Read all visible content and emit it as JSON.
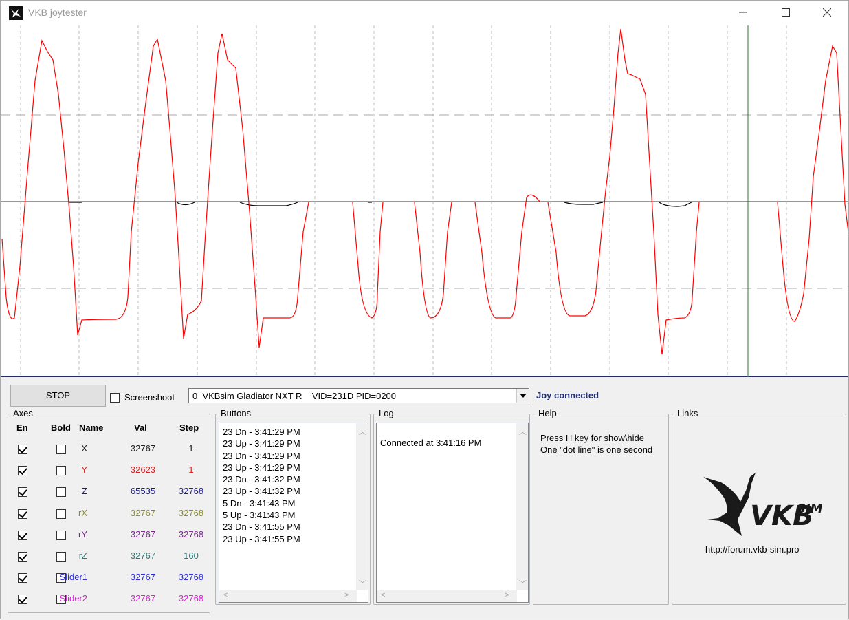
{
  "window": {
    "title": "VKB joytester"
  },
  "controls": {
    "stop_label": "STOP",
    "screenshot_label": "Screenshoot",
    "device_selected": "0  VKBsim Gladiator NXT R    VID=231D PID=0200",
    "status": "Joy connected"
  },
  "axes": {
    "title": "Axes",
    "headers": {
      "en": "En",
      "bold": "Bold",
      "name": "Name",
      "val": "Val",
      "step": "Step"
    },
    "rows": [
      {
        "name": "X",
        "val": "32767",
        "step": "1",
        "color": "#202020",
        "enabled": true,
        "bold": false
      },
      {
        "name": "Y",
        "val": "32623",
        "step": "1",
        "color": "#e02020",
        "enabled": true,
        "bold": false
      },
      {
        "name": "Z",
        "val": "65535",
        "step": "32768",
        "color": "#1a1a8c",
        "enabled": true,
        "bold": false
      },
      {
        "name": "rX",
        "val": "32767",
        "step": "32768",
        "color": "#8a8a2a",
        "enabled": true,
        "bold": false
      },
      {
        "name": "rY",
        "val": "32767",
        "step": "32768",
        "color": "#7a2a8a",
        "enabled": true,
        "bold": false
      },
      {
        "name": "rZ",
        "val": "32767",
        "step": "160",
        "color": "#2a7a7a",
        "enabled": true,
        "bold": false
      },
      {
        "name": "Slider1",
        "val": "32767",
        "step": "32768",
        "color": "#2a2ae0",
        "enabled": true,
        "bold": false
      },
      {
        "name": "Slider2",
        "val": "32767",
        "step": "32768",
        "color": "#e020e0",
        "enabled": true,
        "bold": false
      }
    ]
  },
  "buttons_log": {
    "title": "Buttons",
    "entries": [
      "23 Dn - 3:41:29 PM",
      "23 Up - 3:41:29 PM",
      "23 Dn - 3:41:29 PM",
      "23 Up - 3:41:29 PM",
      "23 Dn - 3:41:32 PM",
      "23 Up - 3:41:32 PM",
      "5 Dn - 3:41:43 PM",
      "5 Up - 3:41:43 PM",
      "23 Dn - 3:41:55 PM",
      "23 Up - 3:41:55 PM"
    ]
  },
  "log": {
    "title": "Log",
    "entries": [
      "Connected at 3:41:16 PM"
    ]
  },
  "help": {
    "title": "Help",
    "text": "Press H key for show\\hide\nOne \"dot line\" is one second"
  },
  "links": {
    "title": "Links",
    "url": "http://forum.vkb-sim.pro",
    "logo_text": "VKB",
    "logo_sup": "SIM"
  },
  "scope": {
    "trace_color": "#ff0000",
    "secondary_color": "#000000",
    "cursor_color": "#2a7a2a"
  }
}
